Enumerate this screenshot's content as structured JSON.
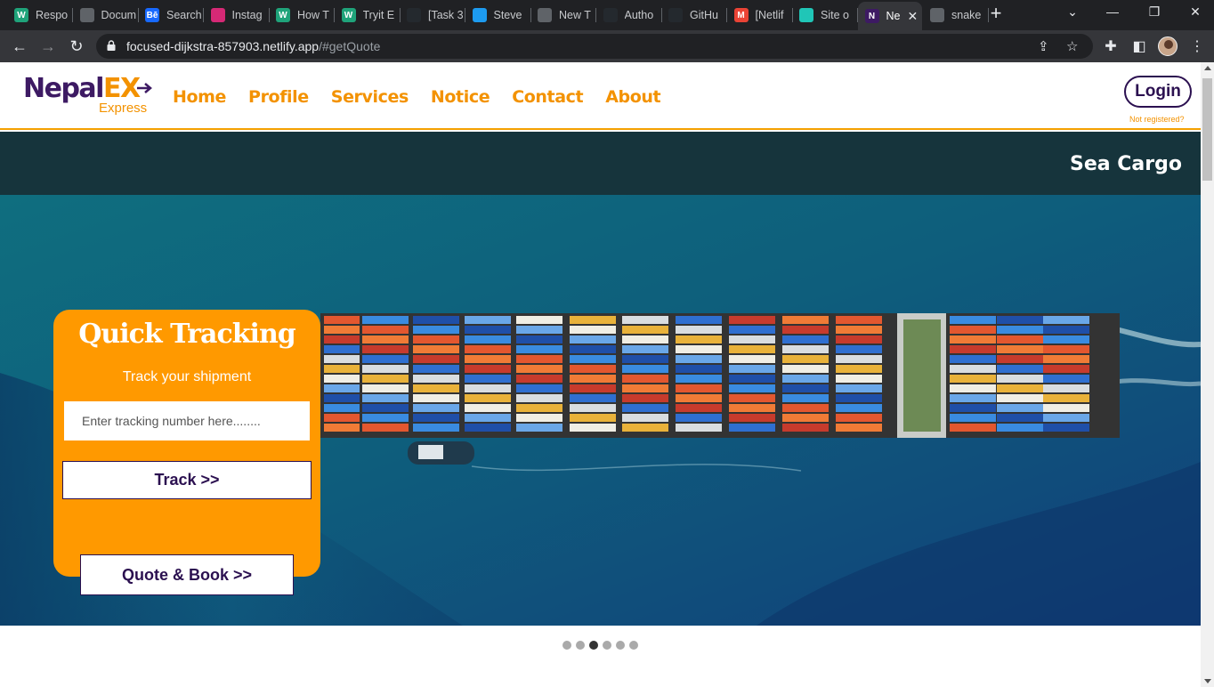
{
  "browser": {
    "tabs": [
      {
        "title": "Respo",
        "icon": "webflow-icon",
        "color": "#1fa37a",
        "glyph": "W"
      },
      {
        "title": "Docum",
        "icon": "globe-icon",
        "color": "#5f6368",
        "glyph": ""
      },
      {
        "title": "Search",
        "icon": "behance-icon",
        "color": "#1769ff",
        "glyph": "Bē"
      },
      {
        "title": "Instag",
        "icon": "instagram-icon",
        "color": "#d62976",
        "glyph": ""
      },
      {
        "title": "How T",
        "icon": "webflow-icon",
        "color": "#1fa37a",
        "glyph": "W"
      },
      {
        "title": "Tryit E",
        "icon": "webflow-icon",
        "color": "#1fa37a",
        "glyph": "W"
      },
      {
        "title": "[Task 3",
        "icon": "github-icon",
        "color": "#24292e",
        "glyph": ""
      },
      {
        "title": "Steve",
        "icon": "twitter-icon",
        "color": "#1d9bf0",
        "glyph": ""
      },
      {
        "title": "New T",
        "icon": "chrome-icon",
        "color": "#5f6368",
        "glyph": ""
      },
      {
        "title": "Autho",
        "icon": "github-icon",
        "color": "#24292e",
        "glyph": ""
      },
      {
        "title": "GitHu",
        "icon": "github-icon",
        "color": "#24292e",
        "glyph": ""
      },
      {
        "title": "[Netlif",
        "icon": "gmail-icon",
        "color": "#ea4335",
        "glyph": "M"
      },
      {
        "title": "Site o",
        "icon": "netlify-icon",
        "color": "#20c6b7",
        "glyph": ""
      },
      {
        "title": "Ne",
        "icon": "nepalex-icon",
        "color": "#3d1a63",
        "glyph": "N",
        "active": true
      },
      {
        "title": "snake",
        "icon": "globe-icon",
        "color": "#5f6368",
        "glyph": ""
      }
    ],
    "url_host": "focused-dijkstra-857903.netlify.app",
    "url_path": "/#getQuote"
  },
  "site": {
    "logo_main": "Nepal",
    "logo_ex": "EX",
    "logo_sub": "Express",
    "nav": [
      "Home",
      "Profile",
      "Services",
      "Notice",
      "Contact",
      "About"
    ],
    "login_label": "Login",
    "not_registered": "Not registered?",
    "brand_colors": {
      "orange": "#f39200",
      "purple": "#2b1050"
    }
  },
  "hero": {
    "title": "Sea Cargo",
    "slides_count": 6,
    "active_slide": 3
  },
  "tracking": {
    "title": "Quick Tracking",
    "subtitle": "Track your shipment",
    "input_placeholder": "Enter tracking number here........",
    "track_button": "Track >>",
    "quote_button": "Quote & Book >>"
  }
}
